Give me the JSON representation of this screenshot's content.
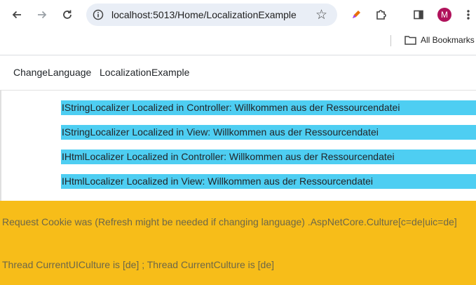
{
  "browser": {
    "url": "localhost:5013/Home/LocalizationExample",
    "profile_initial": "M",
    "bookmarks_label": "All Bookmarks"
  },
  "nav": {
    "links": [
      "ChangeLanguage",
      "LocalizationExample"
    ]
  },
  "messages": [
    "IStringLocalizer Localized in Controller: Willkommen aus der Ressourcendatei",
    "IStringLocalizer Localized in View: Willkommen aus der Ressourcendatei",
    "IHtmlLocalizer Localized in Controller: Willkommen aus der Ressourcendatei",
    "IHtmlLocalizer Localized in View: Willkommen aus der Ressourcendatei"
  ],
  "footer": {
    "cookie_text": "Request Cookie was (Refresh might be needed if changing language) .AspNetCore.Culture[c=de|uic=de]",
    "culture_text": "Thread CurrentUICulture is [de] ; Thread CurrentCulture is [de]"
  },
  "colors": {
    "message_background": "#4ecef2",
    "footer_background": "#f7bd19"
  }
}
